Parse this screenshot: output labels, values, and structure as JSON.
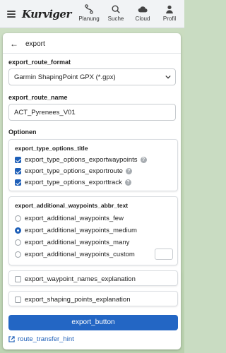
{
  "app": {
    "logo_text": "Kurviger"
  },
  "nav": [
    {
      "label": "Planung",
      "icon": "route-icon"
    },
    {
      "label": "Suche",
      "icon": "search-icon"
    },
    {
      "label": "Cloud",
      "icon": "cloud-icon"
    },
    {
      "label": "Profil",
      "icon": "user-icon"
    }
  ],
  "panel": {
    "title": "export",
    "format_label": "export_route_format",
    "format_value": "Garmin ShapingPoint GPX (*.gpx)",
    "name_label": "export_route_name",
    "name_value": "ACT_Pyrenees_V01",
    "options_label": "Optionen",
    "type_group": {
      "title": "export_type_options_title",
      "items": [
        {
          "label": "export_type_options_exportwaypoints",
          "checked": true
        },
        {
          "label": "export_type_options_exportroute",
          "checked": true
        },
        {
          "label": "export_type_options_exporttrack",
          "checked": true
        }
      ]
    },
    "abbr_group": {
      "title": "export_additional_waypoints_abbr_text",
      "items": [
        {
          "label": "export_additional_waypoints_few",
          "selected": false
        },
        {
          "label": "export_additional_waypoints_medium",
          "selected": true
        },
        {
          "label": "export_additional_waypoints_many",
          "selected": false
        },
        {
          "label": "export_additional_waypoints_custom",
          "selected": false
        }
      ],
      "custom_value": ""
    },
    "waypoint_names": {
      "label": "export_waypoint_names_explanation",
      "checked": false
    },
    "shaping_points": {
      "label": "export_shaping_points_explanation",
      "checked": false
    },
    "export_button": "export_button",
    "transfer_hint": "route_transfer_hint"
  },
  "colors": {
    "accent": "#2366c4",
    "topbar": "#f1f3f5"
  }
}
